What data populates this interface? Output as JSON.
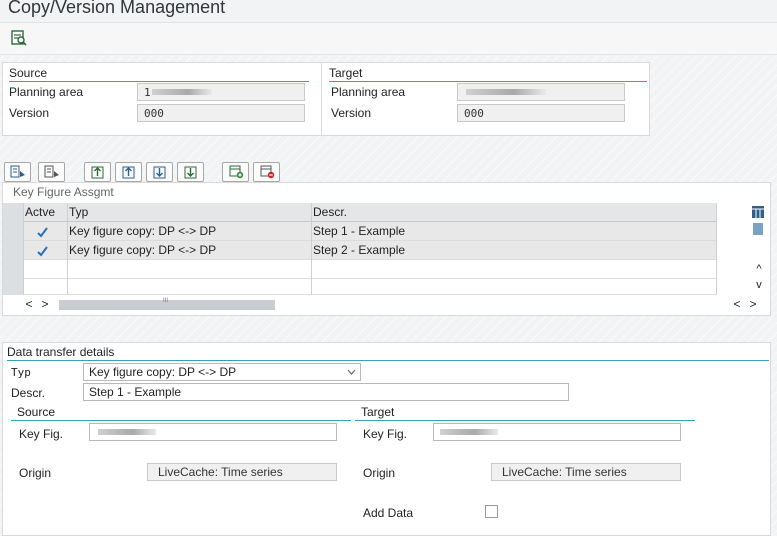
{
  "header": {
    "title": "Copy/Version Management"
  },
  "toolbar": {
    "icons": [
      "display-icon"
    ]
  },
  "source_box": {
    "title": "Source",
    "planning_area_label": "Planning area",
    "planning_area_value": "1",
    "version_label": "Version",
    "version_value": "000"
  },
  "target_box": {
    "title": "Target",
    "planning_area_label": "Planning area",
    "version_label": "Version",
    "version_value": "000"
  },
  "grid_toolbar": {
    "icons": [
      "details-icon",
      "select-all-icon",
      "move-top-icon",
      "move-up-icon",
      "move-down-icon",
      "move-bottom-icon",
      "insert-row-icon",
      "delete-row-icon"
    ]
  },
  "grid": {
    "title": "Key Figure Assgmt",
    "columns": [
      "Actve",
      "Typ",
      "Descr."
    ],
    "rows": [
      {
        "active": true,
        "typ": "Key figure copy: DP <-> DP",
        "descr": "Step 1 - Example"
      },
      {
        "active": true,
        "typ": "Key figure copy: DP <-> DP",
        "descr": "Step 2 - Example"
      }
    ],
    "scroll_left": "<",
    "scroll_right": ">",
    "scroll_up": "^",
    "scroll_down": "v",
    "hscroll_grip": "III"
  },
  "details": {
    "title": "Data transfer details",
    "typ_label": "Typ",
    "typ_value": "Key figure copy: DP <-> DP",
    "descr_label": "Descr.",
    "descr_value": "Step 1 - Example",
    "source": {
      "title": "Source",
      "keyfig_label": "Key Fig.",
      "origin_label": "Origin",
      "origin_value": "LiveCache: Time series"
    },
    "target": {
      "title": "Target",
      "keyfig_label": "Key Fig.",
      "origin_label": "Origin",
      "origin_value": "LiveCache: Time series",
      "add_data_label": "Add Data"
    }
  },
  "colors": {
    "accent": "#3aa0b5",
    "check": "#2a6ebb"
  }
}
